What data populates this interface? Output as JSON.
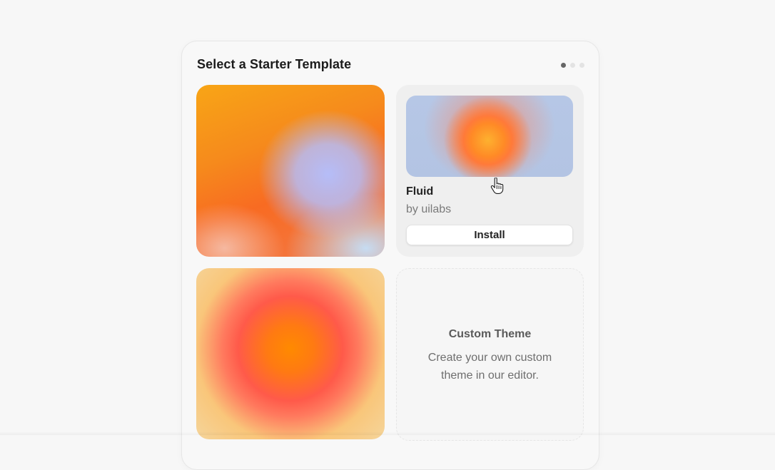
{
  "panel": {
    "title": "Select a Starter Template",
    "pager": {
      "total": 3,
      "active": 1
    }
  },
  "templates": [
    {
      "id": "gradient-orange-blue",
      "colors": [
        "#f8a516",
        "#f86b22",
        "#b5bdf8",
        "#c6dcf2"
      ]
    },
    {
      "id": "fluid",
      "name": "Fluid",
      "author": "by uilabs",
      "button": "Install",
      "colors": [
        "#b6c7e6",
        "#ff8a26",
        "#fdb12f"
      ]
    },
    {
      "id": "gradient-sun",
      "colors": [
        "#ff8a00",
        "#ff5a4a",
        "#f5d59b"
      ]
    }
  ],
  "custom": {
    "title": "Custom Theme",
    "description": "Create your own custom theme in our editor."
  },
  "cursor": {
    "icon": "pointer-hand-icon"
  }
}
